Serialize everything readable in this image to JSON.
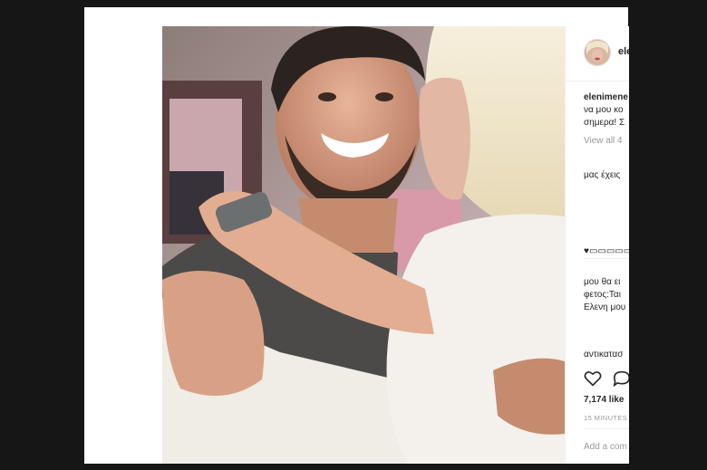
{
  "post": {
    "username": "elenimene",
    "caption_user": "elenimene",
    "caption_lines": [
      "να μου κο",
      "σημερα! Σ"
    ],
    "view_all": "View all 4",
    "comment_1": "μας έχεις",
    "comment_2_prefix": "♥",
    "comment_2_dashes": "▭▭▭▭▭",
    "comment_3_lines": [
      "μου θα ει",
      "φετος:Ται",
      "Ελενη μου"
    ],
    "comment_4": "αντικατασ",
    "likes": "7,174 like",
    "timestamp": "15 MINUTES",
    "add_comment_placeholder": "Add a com"
  },
  "icons": {
    "like": "heart-icon",
    "comment": "comment-icon"
  },
  "colors": {
    "text": "#262626",
    "muted": "#999999",
    "background": "#161616",
    "card": "#ffffff"
  }
}
